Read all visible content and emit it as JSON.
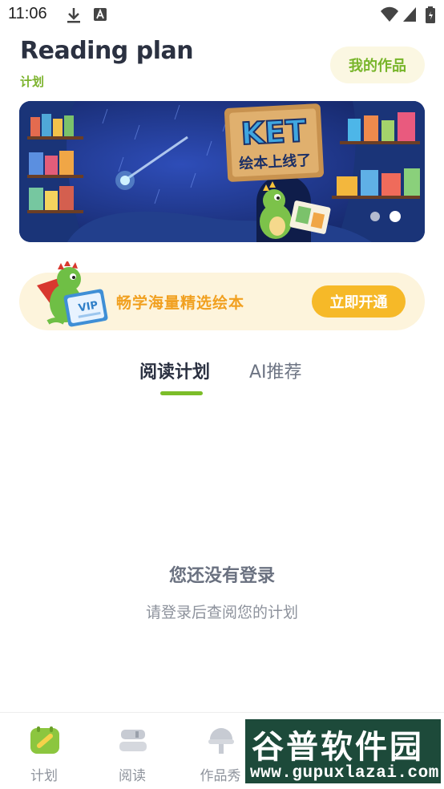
{
  "status_bar": {
    "time": "11:06",
    "icons": [
      "download-icon",
      "text-a-icon",
      "wifi-icon",
      "signal-icon",
      "battery-icon"
    ]
  },
  "header": {
    "title": "Reading plan",
    "subtitle": "计划",
    "works_button": "我的作品"
  },
  "banner": {
    "headline": "KET",
    "subhead": "绘本上线了",
    "page_count": 2,
    "active_page": 2
  },
  "promo": {
    "badge": "VIP",
    "text": "畅学海量精选绘本",
    "button": "立即开通"
  },
  "tabs": [
    {
      "label": "阅读计划",
      "active": true
    },
    {
      "label": "AI推荐",
      "active": false
    }
  ],
  "empty_state": {
    "title": "您还没有登录",
    "subtitle": "请登录后查阅您的计划"
  },
  "bottom_nav": [
    {
      "label": "计划",
      "icon": "plan-icon",
      "active": true
    },
    {
      "label": "阅读",
      "icon": "books-icon",
      "active": false
    },
    {
      "label": "作品秀",
      "icon": "lamp-icon",
      "active": false
    }
  ],
  "watermark": {
    "top": "谷普软件园",
    "bottom": "www.gupuxlazai.com"
  },
  "colors": {
    "accent_green": "#7cbd29",
    "promo_orange": "#f6b928",
    "title_dark": "#2b3141"
  }
}
